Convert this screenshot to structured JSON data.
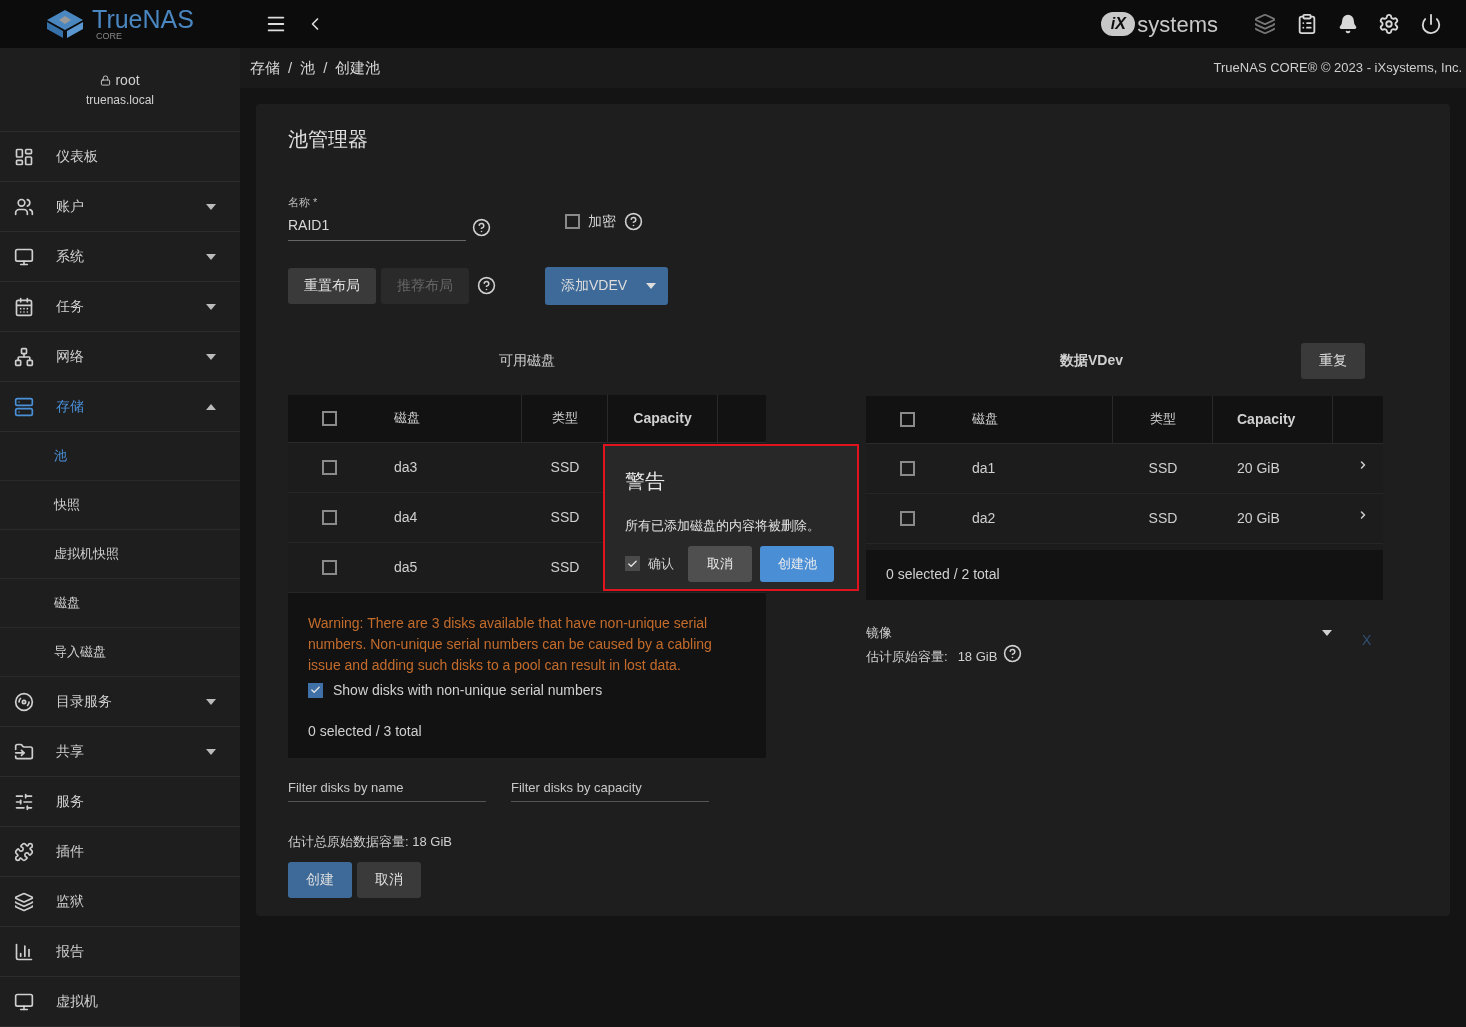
{
  "topbar": {
    "logo": "TrueNAS",
    "logo_sub": "CORE",
    "vendor": "systems",
    "vendor_mark": "iX"
  },
  "user": {
    "name": "root",
    "host": "truenas.local"
  },
  "sidebar": [
    {
      "label": "仪表板",
      "caret": false,
      "selected": false
    },
    {
      "label": "账户",
      "caret": true,
      "expanded": false,
      "selected": false
    },
    {
      "label": "系统",
      "caret": true,
      "expanded": false,
      "selected": false
    },
    {
      "label": "任务",
      "caret": true,
      "expanded": false,
      "selected": false
    },
    {
      "label": "网络",
      "caret": true,
      "expanded": false,
      "selected": false
    },
    {
      "label": "存储",
      "caret": true,
      "expanded": true,
      "selected": true,
      "children": [
        {
          "label": "池",
          "selected": true
        },
        {
          "label": "快照",
          "selected": false
        },
        {
          "label": "虚拟机快照",
          "selected": false
        },
        {
          "label": "磁盘",
          "selected": false
        },
        {
          "label": "导入磁盘",
          "selected": false
        }
      ]
    },
    {
      "label": "目录服务",
      "caret": true,
      "expanded": false,
      "selected": false
    },
    {
      "label": "共享",
      "caret": true,
      "expanded": false,
      "selected": false
    },
    {
      "label": "服务",
      "caret": false,
      "selected": false
    },
    {
      "label": "插件",
      "caret": false,
      "selected": false
    },
    {
      "label": "监狱",
      "caret": false,
      "selected": false
    },
    {
      "label": "报告",
      "caret": false,
      "selected": false
    },
    {
      "label": "虚拟机",
      "caret": false,
      "selected": false
    }
  ],
  "breadcrumb": [
    {
      "kind": "link",
      "text": "存储"
    },
    {
      "kind": "separator",
      "text": "/"
    },
    {
      "kind": "link",
      "text": "池"
    },
    {
      "kind": "separator",
      "text": "/"
    },
    {
      "kind": "current",
      "text": "创建池"
    }
  ],
  "copyright": "TrueNAS CORE® © 2023 - iXsystems, Inc.",
  "page_title": "池管理器",
  "name_field": {
    "label": "名称",
    "required_mark": "*",
    "value": "RAID1"
  },
  "encrypt": {
    "label": "加密",
    "checked": false
  },
  "buttons": {
    "reset": "重置布局",
    "suggest": "推荐布局",
    "suggest_disabled": true,
    "add_vdev": "添加VDEV"
  },
  "available": {
    "title": "可用磁盘",
    "select_all_checked": false,
    "columns": [
      "磁盘",
      "类型",
      "Capacity"
    ],
    "rows": [
      {
        "disk": "da3",
        "type": "SSD",
        "checked": false
      },
      {
        "disk": "da4",
        "type": "SSD",
        "checked": false
      },
      {
        "disk": "da5",
        "type": "SSD",
        "checked": false
      }
    ],
    "warning": "Warning: There are 3 disks available that have non-unique serial numbers. Non-unique serial numbers can be caused by a cabling issue and adding such disks to a pool can result in lost data.",
    "show_nonunique": {
      "label": "Show disks with non-unique serial numbers",
      "checked": true
    },
    "footer": "0 selected / 3 total"
  },
  "data_vdev": {
    "title": "数据VDev",
    "repeat_button": "重复",
    "select_all_checked": false,
    "columns": [
      "磁盘",
      "类型",
      "Capacity"
    ],
    "rows": [
      {
        "disk": "da1",
        "type": "SSD",
        "capacity": "20 GiB",
        "checked": false
      },
      {
        "disk": "da2",
        "type": "SSD",
        "capacity": "20 GiB",
        "checked": false
      }
    ],
    "footer": "0 selected / 2 total",
    "layout": "镜像",
    "remove": "X",
    "capacity_label": "估计原始容量:",
    "capacity_value": "18 GiB"
  },
  "filters": [
    {
      "placeholder": "Filter disks by name"
    },
    {
      "placeholder": "Filter disks by capacity"
    }
  ],
  "total_capacity": "估计总原始数据容量: 18 GiB",
  "actions": [
    {
      "label": "创建",
      "primary": true
    },
    {
      "label": "取消",
      "primary": false
    }
  ],
  "dialog": {
    "title": "警告",
    "message": "所有已添加磁盘的内容将被删除。",
    "confirm": {
      "label": "确认",
      "checked": true
    },
    "cancel": "取消",
    "submit": "创建池"
  }
}
